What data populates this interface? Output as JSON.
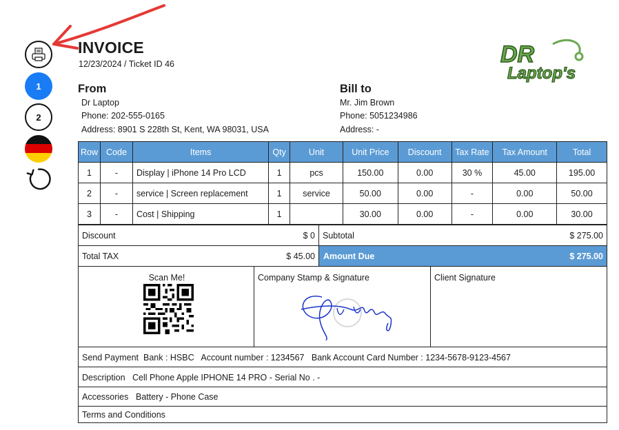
{
  "toolbar": {
    "page_1": "1",
    "page_2": "2",
    "icons": [
      "printer-icon",
      "germany-flag-icon",
      "reload-icon"
    ],
    "active_color": "#1a7cf5"
  },
  "invoice": {
    "title": "INVOICE",
    "subtitle": "12/23/2024 / Ticket ID 46",
    "logo_text_top": "DR",
    "logo_text_bottom": "Laptop's"
  },
  "from": {
    "heading": "From",
    "name": "Dr Laptop",
    "phone": "Phone: 202-555-0165",
    "address": "Address: 8901 S 228th St, Kent, WA 98031, USA"
  },
  "bill_to": {
    "heading": "Bill to",
    "name": "Mr. Jim Brown",
    "phone": "Phone: 5051234986",
    "address": "Address: -"
  },
  "table": {
    "headers": [
      "Row",
      "Code",
      "Items",
      "Qty",
      "Unit",
      "Unit Price",
      "Discount",
      "Tax Rate",
      "Tax Amount",
      "Total"
    ],
    "rows": [
      [
        "1",
        "-",
        "Display | iPhone 14 Pro LCD",
        "1",
        "pcs",
        "150.00",
        "0.00",
        "30 %",
        "45.00",
        "195.00"
      ],
      [
        "2",
        "-",
        "service | Screen replacement",
        "1",
        "service",
        "50.00",
        "0.00",
        "-",
        "0.00",
        "50.00"
      ],
      [
        "3",
        "-",
        "Cost | Shipping",
        "1",
        "",
        "30.00",
        "0.00",
        "-",
        "0.00",
        "30.00"
      ]
    ],
    "header_color": "#5b9bd5"
  },
  "totals": {
    "discount_label": "Discount",
    "discount_value": "$ 0",
    "subtotal_label": "Subtotal",
    "subtotal_value": "$ 275.00",
    "tax_label": "Total TAX",
    "tax_value": "$ 45.00",
    "amount_due_label": "Amount Due",
    "amount_due_value": "$ 275.00"
  },
  "signatures": {
    "scan_label": "Scan Me!",
    "company_label": "Company Stamp & Signature",
    "client_label": "Client Signature"
  },
  "footer": {
    "payment_label": "Send Payment",
    "payment_value": "Bank : HSBC   Account number : 1234567   Bank Account Card Number : 1234-5678-9123-4567",
    "description_label": "Description",
    "description_value": "Cell Phone Apple IPHONE 14 PRO - Serial No . -",
    "accessories_label": "Accessories",
    "accessories_value": "Battery - Phone Case",
    "terms_label": "Terms and Conditions"
  }
}
